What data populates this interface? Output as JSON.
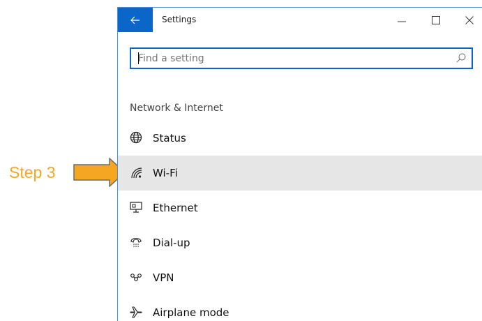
{
  "annotation": {
    "step_label": "Step 3",
    "color": "#f5a623"
  },
  "window": {
    "title": "Settings",
    "accent_color": "#0a66c8",
    "controls": [
      "minimize-icon",
      "maximize-icon",
      "close-icon"
    ]
  },
  "search": {
    "placeholder": "Find a setting",
    "value": ""
  },
  "section": {
    "heading": "Network & Internet"
  },
  "nav": {
    "items": [
      {
        "label": "Status",
        "icon": "globe-icon",
        "selected": false
      },
      {
        "label": "Wi-Fi",
        "icon": "wifi-icon",
        "selected": true
      },
      {
        "label": "Ethernet",
        "icon": "ethernet-icon",
        "selected": false
      },
      {
        "label": "Dial-up",
        "icon": "dialup-icon",
        "selected": false
      },
      {
        "label": "VPN",
        "icon": "vpn-icon",
        "selected": false
      },
      {
        "label": "Airplane mode",
        "icon": "airplane-icon",
        "selected": false
      }
    ]
  }
}
